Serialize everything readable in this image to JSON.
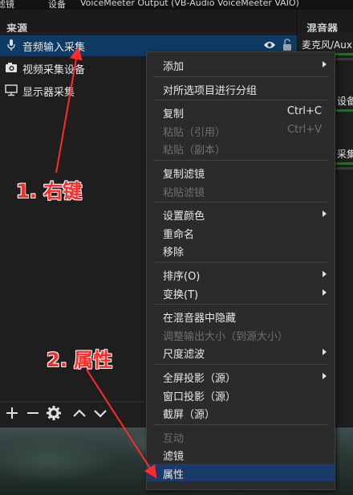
{
  "topbar": {
    "left_tab": "滤镜",
    "tab_settings": "设备",
    "device": "VoiceMeeter Output (VB-Audio VoiceMeeter VAIO)"
  },
  "sources_panel": {
    "title": "来源",
    "items": [
      {
        "label": "音频输入采集",
        "icon": "microphone-icon",
        "selected": true
      },
      {
        "label": "视频采集设备",
        "icon": "camera-icon",
        "selected": false
      },
      {
        "label": "显示器采集",
        "icon": "monitor-icon",
        "selected": false
      }
    ]
  },
  "mixer_panel": {
    "title": "混音器",
    "items": [
      {
        "label": "麦克风/Aux"
      },
      {
        "label": "设备"
      },
      {
        "label": "采集"
      }
    ]
  },
  "context_menu": {
    "items": [
      {
        "label": "添加",
        "submenu": true,
        "disabled": false
      },
      {
        "sep": true
      },
      {
        "label": "对所选项目进行分组",
        "disabled": false
      },
      {
        "sep": true
      },
      {
        "label": "复制",
        "shortcut": "Ctrl+C",
        "disabled": false
      },
      {
        "label": "粘贴（引用）",
        "shortcut": "Ctrl+V",
        "disabled": true
      },
      {
        "label": "粘贴（副本）",
        "disabled": true
      },
      {
        "sep": true
      },
      {
        "label": "复制滤镜",
        "disabled": false
      },
      {
        "label": "粘贴滤镜",
        "disabled": true
      },
      {
        "sep": true
      },
      {
        "label": "设置颜色",
        "submenu": true,
        "disabled": false
      },
      {
        "label": "重命名",
        "disabled": false
      },
      {
        "label": "移除",
        "disabled": false
      },
      {
        "sep": true
      },
      {
        "label": "排序(O)",
        "submenu": true,
        "disabled": false
      },
      {
        "label": "变换(T)",
        "submenu": true,
        "disabled": false
      },
      {
        "sep": true
      },
      {
        "label": "在混音器中隐藏",
        "disabled": false
      },
      {
        "label": "调整输出大小（到源大小）",
        "disabled": true
      },
      {
        "label": "尺度滤波",
        "submenu": true,
        "disabled": false
      },
      {
        "sep": true
      },
      {
        "label": "全屏投影（源）",
        "submenu": true,
        "disabled": false
      },
      {
        "label": "窗口投影（源）",
        "disabled": false
      },
      {
        "label": "截屏（源）",
        "disabled": false
      },
      {
        "sep": true
      },
      {
        "label": "互动",
        "disabled": true
      },
      {
        "label": "滤镜",
        "disabled": false
      },
      {
        "label": "属性",
        "disabled": false,
        "highlighted": true
      }
    ]
  },
  "annotations": {
    "step1": "1. 右键",
    "step2": "2. 属性",
    "color": "#ff2a2a"
  },
  "colors": {
    "selection": "#0e3b63",
    "menu_highlight": "#1a3b6a",
    "background": "#1f1e1f"
  }
}
